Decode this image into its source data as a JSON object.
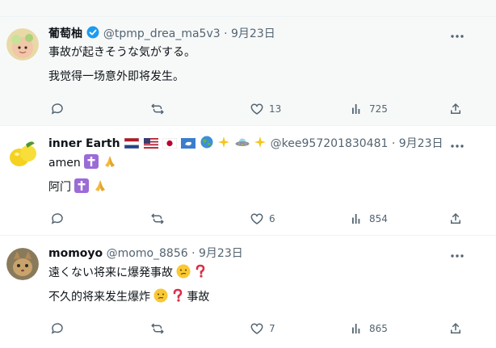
{
  "posts": [
    {
      "name": "葡萄柚",
      "handle": "@tpmp_drea_ma5v3",
      "dot": "·",
      "date": "9月23日",
      "text1": "事故が起きそうな気がする。",
      "text2": "我觉得一场意外即将发生。",
      "replies": "",
      "reposts": "",
      "likes": "13",
      "views": "725",
      "verified": true
    },
    {
      "name": "inner Earth",
      "handle": "@kee957201830481",
      "dot": "·",
      "date": "9月23日",
      "text1": "amen",
      "text2": "阿门",
      "replies": "",
      "reposts": "",
      "likes": "6",
      "views": "854"
    },
    {
      "name": "momoyo",
      "handle": "@momo_8856",
      "dot": "·",
      "date": "9月23日",
      "text1a": "遠くない将来に爆発事故",
      "text2a": "不久的将来发生爆炸",
      "text2b": "事故",
      "replies": "",
      "reposts": "",
      "likes": "7",
      "views": "865"
    }
  ],
  "colors": {
    "text": "#0f1419",
    "muted": "#536471",
    "verified": "#1d9bf0",
    "divider": "#eff3f4",
    "highlight_bg": "#f7f9f9"
  },
  "icons": [
    "reply-icon",
    "repost-icon",
    "like-icon",
    "views-icon",
    "share-icon",
    "more-icon",
    "verified-badge-icon"
  ]
}
